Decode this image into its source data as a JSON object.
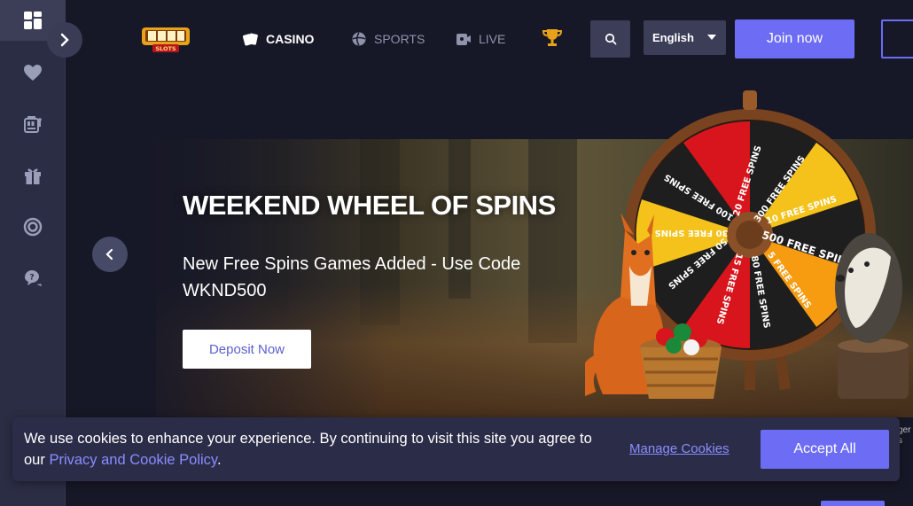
{
  "sidebar": {
    "items": [
      {
        "icon": "dashboard-icon"
      },
      {
        "icon": "heart-icon"
      },
      {
        "icon": "slot-machine-icon"
      },
      {
        "icon": "gift-icon"
      },
      {
        "icon": "lifebuoy-icon"
      },
      {
        "icon": "support-chat-icon"
      }
    ],
    "toggle_icon": "chevron-right-icon"
  },
  "header": {
    "logo_text": "SLOTS",
    "nav": [
      {
        "label": "CASINO",
        "icon": "cards-icon",
        "active": true
      },
      {
        "label": "SPORTS",
        "icon": "ball-icon",
        "active": false
      },
      {
        "label": "LIVE",
        "icon": "live-dealer-icon",
        "active": false
      }
    ],
    "trophy_icon": "trophy-icon",
    "search_icon": "search-icon",
    "language": "English",
    "join_label": "Join now"
  },
  "banner": {
    "title": "WEEKEND WHEEL OF SPINS",
    "subtitle": "New Free Spins Games Added - Use Code WKND500",
    "cta_label": "Deposit Now",
    "wheel_segments": [
      "20 FREE SPINS",
      "300 FREE SPINS",
      "10 FREE SPINS",
      "500 FREE SPINS",
      "5 FREE SPINS",
      "80 FREE SPINS",
      "15 FREE SPINS",
      "50 FREE SPINS",
      "30 FREE SPINS",
      "100 FREE SPINS"
    ]
  },
  "cookie": {
    "text_before": "We use cookies to enhance your experience. By continuing to visit this site you agree to our ",
    "link_text": "Privacy and Cookie Policy",
    "text_after": ".",
    "manage_label": "Manage Cookies",
    "accept_label": "Accept All"
  },
  "colors": {
    "accent": "#6c6cf5",
    "sidebar_bg": "#2b2d44",
    "page_bg": "#171827",
    "gold": "#e8a21a"
  }
}
